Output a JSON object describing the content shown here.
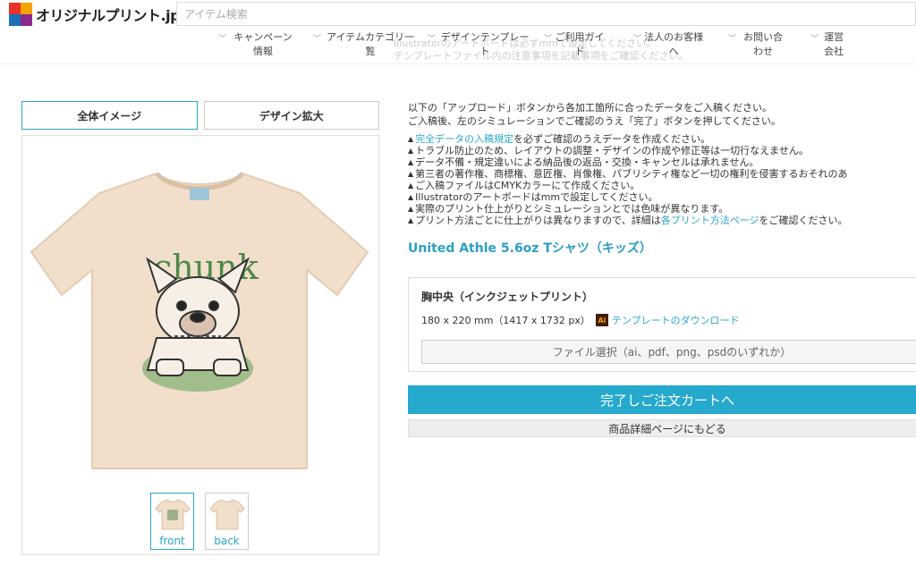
{
  "header": {
    "logo_text": "オリジナルプリント.jp",
    "search_placeholder": "アイテム検索",
    "ghost_line1": "Illustratorのアートボードは必ずmmで設定してください。",
    "ghost_line2": "テンプレートファイル内の注意事項を記載事項をご確認ください。"
  },
  "nav": [
    {
      "label": "キャンペーン情報"
    },
    {
      "label": "アイテムカテゴリ一覧"
    },
    {
      "label": "デザインテンプレート"
    },
    {
      "label": "ご利用ガイド"
    },
    {
      "label": "法人のお客様へ"
    },
    {
      "label": "お問い合わせ"
    },
    {
      "label": "運営会社"
    }
  ],
  "tabs": {
    "overall": "全体イメージ",
    "zoom": "デザイン拡大"
  },
  "preview": {
    "design_text": "chunk",
    "tshirt_color": "#f1dfcb",
    "design_color": "#4f8a4a"
  },
  "thumbs": {
    "front": "front",
    "back": "back"
  },
  "instructions": {
    "line1": "以下の「アップロード」ボタンから各加工箇所に合ったデータをご入稿ください。",
    "line2": "ご入稿後、左のシミュレーションでご確認のうえ「完了」ボタンを押してください。",
    "n1_link": "完全データの入稿規定",
    "n1_rest": "を必ずご確認のうえデータを作成ください。",
    "n2": "トラブル防止のため、レイアウトの調整・デザインの作成や修正等は一切行なえません。",
    "n3": "データ不備・規定違いによる納品後の返品・交換・キャンセルは承れません。",
    "n4": "第三者の著作権、商標権、意匠権、肖像権、パブリシティ権など一切の権利を侵害するおそれのあ",
    "n5": "ご入稿ファイルはCMYKカラーにて作成ください。",
    "n6": "Illustratorのアートボードはmmで設定してください。",
    "n7": "実際のプリント仕上がりとシミュレーションとでは色味が異なります。",
    "n8_pre": "プリント方法ごとに仕上がりは異なりますので、詳細は",
    "n8_link": "各プリント方法ページ",
    "n8_post": "をご確認ください。"
  },
  "product": {
    "name": "United Athle 5.6oz Tシャツ（キッズ）"
  },
  "spec": {
    "title": "胸中央（インクジェットプリント）",
    "size": "180 x 220 mm（1417 x 1732 px）",
    "ai_icon": "Ai",
    "template_link": "テンプレートのダウンロード",
    "file_button": "ファイル選択（ai、pdf、png、psdのいずれか）"
  },
  "actions": {
    "complete": "完了しご注文カートへ",
    "back": "商品詳細ページにもどる"
  },
  "colors": {
    "accent": "#25a9cc",
    "link": "#2aa8c8"
  }
}
